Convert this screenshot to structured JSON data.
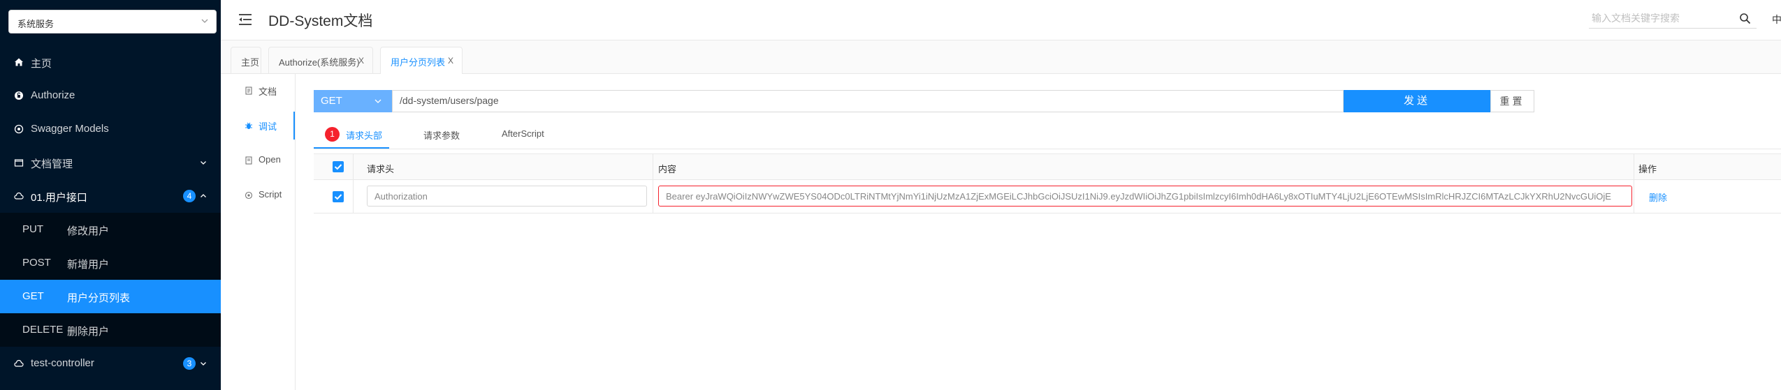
{
  "sidebar": {
    "service_select": "系统服务",
    "menu": [
      {
        "label": "主页",
        "icon": "home-icon"
      },
      {
        "label": "Authorize",
        "icon": "unlock-icon"
      },
      {
        "label": "Swagger Models",
        "icon": "code-icon"
      },
      {
        "label": "文档管理",
        "icon": "folder-icon"
      },
      {
        "label": "01.用户接口",
        "icon": "cloud-icon",
        "badge": "4"
      },
      {
        "label": "test-controller",
        "icon": "cloud-icon",
        "badge": "3"
      }
    ],
    "api_items": [
      {
        "method": "PUT",
        "name": "修改用户"
      },
      {
        "method": "POST",
        "name": "新增用户"
      },
      {
        "method": "GET",
        "name": "用户分页列表"
      },
      {
        "method": "DELETE",
        "name": "删除用户"
      }
    ]
  },
  "header": {
    "title": "DD-System文档",
    "search_placeholder": "输入文档关键字搜索",
    "lang": "中"
  },
  "tabs": [
    {
      "label": "主页",
      "closable": false
    },
    {
      "label": "Authorize(系统服务)",
      "closable": true
    },
    {
      "label": "用户分页列表",
      "closable": true
    }
  ],
  "tab_close": "X",
  "side_nav": [
    {
      "label": "文档",
      "icon": "file-icon"
    },
    {
      "label": "调试",
      "icon": "bug-icon"
    },
    {
      "label": "Open",
      "icon": "file-icon"
    },
    {
      "label": "Script",
      "icon": "code-icon"
    }
  ],
  "request": {
    "method": "GET",
    "url": "/dd-system/users/page",
    "send_label": "发送",
    "reset_label": "重置"
  },
  "request_tabs": [
    "请求头部",
    "请求参数",
    "AfterScript"
  ],
  "error_count": "1",
  "table": {
    "headers": [
      "请求头",
      "内容",
      "操作"
    ],
    "rows": [
      {
        "name": "Authorization",
        "value": "Bearer eyJraWQiOiIzNWYwZWE5YS04ODc0LTRiNTMtYjNmYi1iNjUzMzA1ZjExMGEiLCJhbGciOiJSUzI1NiJ9.eyJzdWIiOiJhZG1pbiIsImlzcyI6Imh0dHA6Ly8xOTIuMTY4LjU2LjE6OTEwMSIsImRlcHRJZCI6MTAzLCJkYXRhU2NvcGUiOjE",
        "action": "删除"
      }
    ]
  },
  "colors": {
    "sidebar_bg": "#001529",
    "accent": "#1890ff",
    "error": "#f5222d"
  }
}
